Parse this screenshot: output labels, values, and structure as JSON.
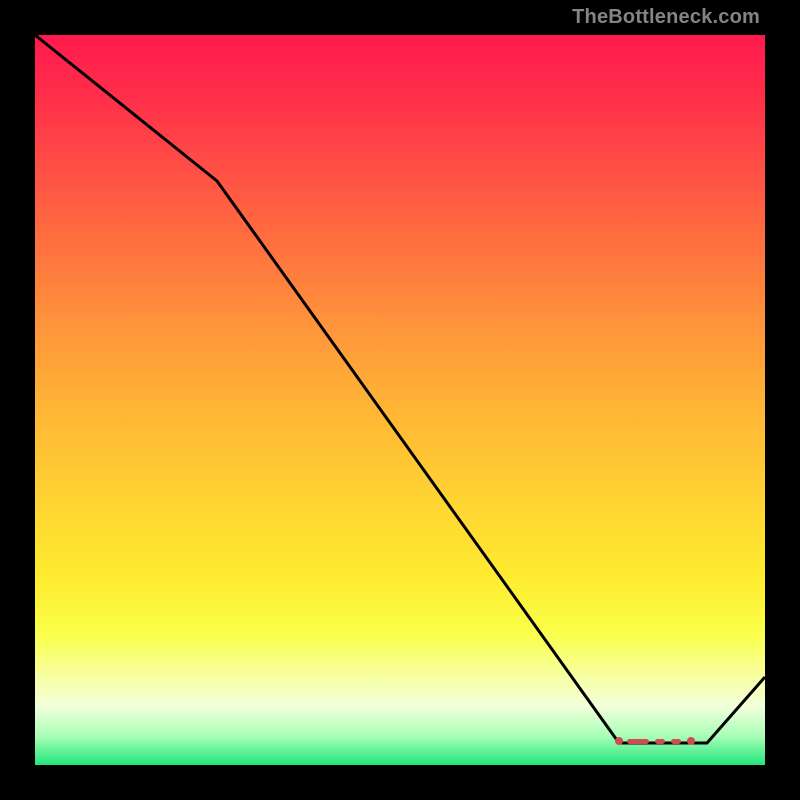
{
  "watermark": "TheBottleneck.com",
  "colors": {
    "line": "#000000",
    "marker": "#d24a54",
    "gradient_top": "#ff1a4d",
    "gradient_bottom": "#22e57b"
  },
  "chart_data": {
    "type": "line",
    "title": "",
    "xlabel": "",
    "ylabel": "",
    "xlim": [
      0,
      100
    ],
    "ylim": [
      0,
      100
    ],
    "series": [
      {
        "name": "curve",
        "x": [
          0,
          25,
          80,
          92,
          100
        ],
        "values": [
          100,
          80,
          3,
          3,
          12
        ]
      }
    ],
    "flat_region": {
      "x_start": 80,
      "x_end": 92,
      "y": 3
    },
    "annotations": [
      {
        "text": "TheBottleneck.com",
        "position": "top-right"
      }
    ]
  }
}
